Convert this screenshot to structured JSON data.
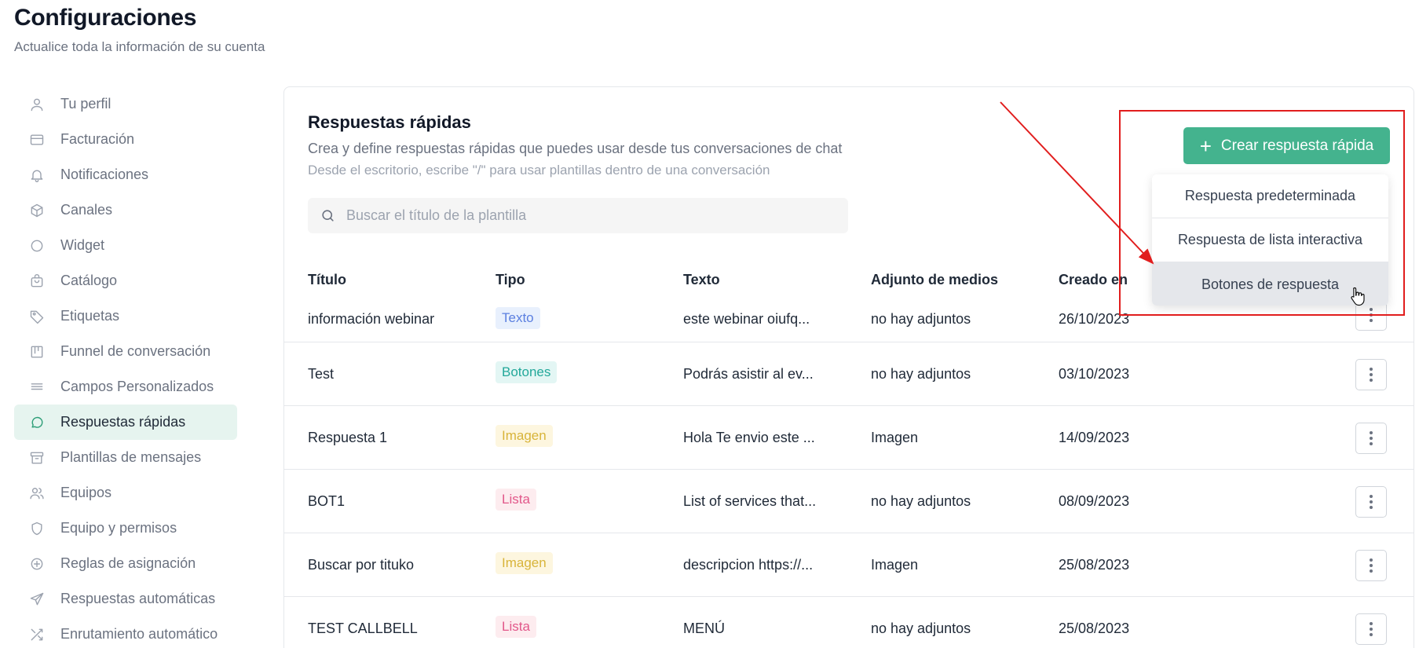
{
  "header": {
    "title": "Configuraciones",
    "subtitle": "Actualice toda la información de su cuenta"
  },
  "sidebar": {
    "items": [
      {
        "label": "Tu perfil",
        "icon": "user-icon"
      },
      {
        "label": "Facturación",
        "icon": "credit-card-icon"
      },
      {
        "label": "Notificaciones",
        "icon": "bell-icon"
      },
      {
        "label": "Canales",
        "icon": "cube-icon"
      },
      {
        "label": "Widget",
        "icon": "circle-icon"
      },
      {
        "label": "Catálogo",
        "icon": "shopping-bag-icon"
      },
      {
        "label": "Etiquetas",
        "icon": "tag-icon"
      },
      {
        "label": "Funnel de conversación",
        "icon": "kanban-icon"
      },
      {
        "label": "Campos Personalizados",
        "icon": "lines-icon"
      },
      {
        "label": "Respuestas rápidas",
        "icon": "chat-bubble-icon"
      },
      {
        "label": "Plantillas de mensajes",
        "icon": "archive-icon"
      },
      {
        "label": "Equipos",
        "icon": "users-icon"
      },
      {
        "label": "Equipo y permisos",
        "icon": "shield-icon"
      },
      {
        "label": "Reglas de asignación",
        "icon": "plus-circle-icon"
      },
      {
        "label": "Respuestas automáticas",
        "icon": "send-icon"
      },
      {
        "label": "Enrutamiento automático",
        "icon": "shuffle-icon"
      }
    ],
    "active_index": 9
  },
  "card": {
    "title": "Respuestas rápidas",
    "description": "Crea y define respuestas rápidas que puedes usar desde tus conversaciones de chat",
    "hint": "Desde el escritorio, escribe \"/\" para usar plantillas dentro de una conversación",
    "search_placeholder": "Buscar el título de la plantilla"
  },
  "table": {
    "columns": [
      "Título",
      "Tipo",
      "Texto",
      "Adjunto de medios",
      "Creado en"
    ],
    "rows": [
      {
        "title": "información webinar",
        "type": "Texto",
        "type_style": "texto",
        "text": "este webinar oiufq...",
        "media": "no hay adjuntos",
        "created": "26/10/2023"
      },
      {
        "title": "Test",
        "type": "Botones",
        "type_style": "botones",
        "text": "Podrás asistir al ev...",
        "media": "no hay adjuntos",
        "created": "03/10/2023"
      },
      {
        "title": "Respuesta 1",
        "type": "Imagen",
        "type_style": "imagen",
        "text": "Hola Te envio este ...",
        "media": "Imagen",
        "created": "14/09/2023"
      },
      {
        "title": "BOT1",
        "type": "Lista",
        "type_style": "lista",
        "text": "List of services that...",
        "media": "no hay adjuntos",
        "created": "08/09/2023"
      },
      {
        "title": "Buscar por tituko",
        "type": "Imagen",
        "type_style": "imagen",
        "text": "descripcion https://...",
        "media": "Imagen",
        "created": "25/08/2023"
      },
      {
        "title": "TEST CALLBELL",
        "type": "Lista",
        "type_style": "lista",
        "text": "MENÚ",
        "media": "no hay adjuntos",
        "created": "25/08/2023"
      }
    ]
  },
  "create_button": {
    "label": "Crear respuesta rápida",
    "icon": "plus-icon"
  },
  "dropdown": {
    "items": [
      "Respuesta predeterminada",
      "Respuesta de lista interactiva",
      "Botones de respuesta"
    ],
    "hovered_index": 2
  },
  "colors": {
    "accent": "#44b38e",
    "active_bg": "#e6f4ef",
    "annotation": "#e11d1d"
  }
}
